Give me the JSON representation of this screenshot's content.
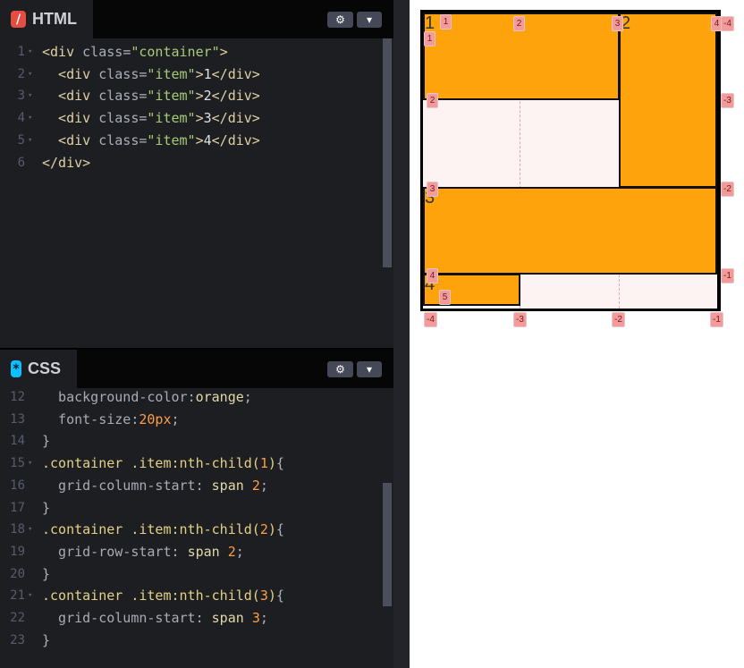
{
  "html_panel": {
    "title": "HTML",
    "icon": "/",
    "settings_icon": "⚙",
    "collapse_icon": "▾",
    "lines": [
      {
        "num": "1",
        "parts": [
          [
            "t-tag",
            "<div "
          ],
          [
            "t-attr",
            "class"
          ],
          [
            "t-punc",
            "="
          ],
          [
            "t-str",
            "\"container\""
          ],
          [
            "t-tag",
            ">"
          ]
        ]
      },
      {
        "num": "2",
        "parts": [
          [
            "t-tag",
            "  <div "
          ],
          [
            "t-attr",
            "class"
          ],
          [
            "t-punc",
            "="
          ],
          [
            "t-str",
            "\"item\""
          ],
          [
            "t-tag",
            ">"
          ],
          [
            "t-txt",
            "1"
          ],
          [
            "t-tag",
            "</div>"
          ]
        ]
      },
      {
        "num": "3",
        "parts": [
          [
            "t-tag",
            "  <div "
          ],
          [
            "t-attr",
            "class"
          ],
          [
            "t-punc",
            "="
          ],
          [
            "t-str",
            "\"item\""
          ],
          [
            "t-tag",
            ">"
          ],
          [
            "t-txt",
            "2"
          ],
          [
            "t-tag",
            "</div>"
          ]
        ]
      },
      {
        "num": "4",
        "parts": [
          [
            "t-tag",
            "  <div "
          ],
          [
            "t-attr",
            "class"
          ],
          [
            "t-punc",
            "="
          ],
          [
            "t-str",
            "\"item\""
          ],
          [
            "t-tag",
            ">"
          ],
          [
            "t-txt",
            "3"
          ],
          [
            "t-tag",
            "</div>"
          ]
        ]
      },
      {
        "num": "5",
        "parts": [
          [
            "t-tag",
            "  <div "
          ],
          [
            "t-attr",
            "class"
          ],
          [
            "t-punc",
            "="
          ],
          [
            "t-str",
            "\"item\""
          ],
          [
            "t-tag",
            ">"
          ],
          [
            "t-txt",
            "4"
          ],
          [
            "t-tag",
            "</div>"
          ]
        ]
      },
      {
        "num": "6",
        "parts": [
          [
            "t-tag",
            "</div>"
          ]
        ]
      }
    ]
  },
  "css_panel": {
    "title": "CSS",
    "icon": "*",
    "settings_icon": "⚙",
    "collapse_icon": "▾",
    "lines": [
      {
        "num": "12",
        "parts": [
          [
            "t-prop",
            "  background-color"
          ],
          [
            "t-punc",
            ":"
          ],
          [
            "t-val",
            "orange"
          ],
          [
            "t-punc",
            ";"
          ]
        ]
      },
      {
        "num": "13",
        "parts": [
          [
            "t-prop",
            "  font-size"
          ],
          [
            "t-punc",
            ":"
          ],
          [
            "t-num",
            "20px"
          ],
          [
            "t-punc",
            ";"
          ]
        ]
      },
      {
        "num": "14",
        "parts": [
          [
            "t-punc",
            "}"
          ]
        ]
      },
      {
        "num": "15",
        "parts": [
          [
            "t-sel",
            ".container .item:nth-child("
          ],
          [
            "t-num",
            "1"
          ],
          [
            "t-sel",
            ")"
          ],
          [
            "t-punc",
            "{"
          ]
        ]
      },
      {
        "num": "16",
        "parts": [
          [
            "t-prop",
            "  grid-column-start"
          ],
          [
            "t-punc",
            ": "
          ],
          [
            "t-val",
            "span "
          ],
          [
            "t-num",
            "2"
          ],
          [
            "t-punc",
            ";"
          ]
        ]
      },
      {
        "num": "17",
        "parts": [
          [
            "t-punc",
            "}"
          ]
        ]
      },
      {
        "num": "18",
        "parts": [
          [
            "t-sel",
            ".container .item:nth-child("
          ],
          [
            "t-num",
            "2"
          ],
          [
            "t-sel",
            ")"
          ],
          [
            "t-punc",
            "{"
          ]
        ]
      },
      {
        "num": "19",
        "parts": [
          [
            "t-prop",
            "  grid-row-start"
          ],
          [
            "t-punc",
            ": "
          ],
          [
            "t-val",
            "span "
          ],
          [
            "t-num",
            "2"
          ],
          [
            "t-punc",
            ";"
          ]
        ]
      },
      {
        "num": "20",
        "parts": [
          [
            "t-punc",
            "}"
          ]
        ]
      },
      {
        "num": "21",
        "parts": [
          [
            "t-sel",
            ".container .item:nth-child("
          ],
          [
            "t-num",
            "3"
          ],
          [
            "t-sel",
            ")"
          ],
          [
            "t-punc",
            "{"
          ]
        ]
      },
      {
        "num": "22",
        "parts": [
          [
            "t-prop",
            "  grid-column-start"
          ],
          [
            "t-punc",
            ": "
          ],
          [
            "t-val",
            "span "
          ],
          [
            "t-num",
            "3"
          ],
          [
            "t-punc",
            ";"
          ]
        ]
      },
      {
        "num": "23",
        "parts": [
          [
            "t-punc",
            "}"
          ]
        ]
      }
    ]
  },
  "preview": {
    "items": [
      "1",
      "2",
      "3",
      "4"
    ],
    "column_badges_top": [
      "1",
      "2",
      "3",
      "4"
    ],
    "column_badges_bottom": [
      "-4",
      "-3",
      "-2",
      "-1"
    ],
    "row_badges_left": [
      "1",
      "2",
      "3",
      "4",
      "5"
    ],
    "row_badges_right": [
      "-4",
      "-3",
      "-2",
      "-1"
    ],
    "colors": {
      "item": "#ffa30d",
      "badge": "#f59a9a",
      "empty_cell": "#fdf3f3"
    }
  }
}
